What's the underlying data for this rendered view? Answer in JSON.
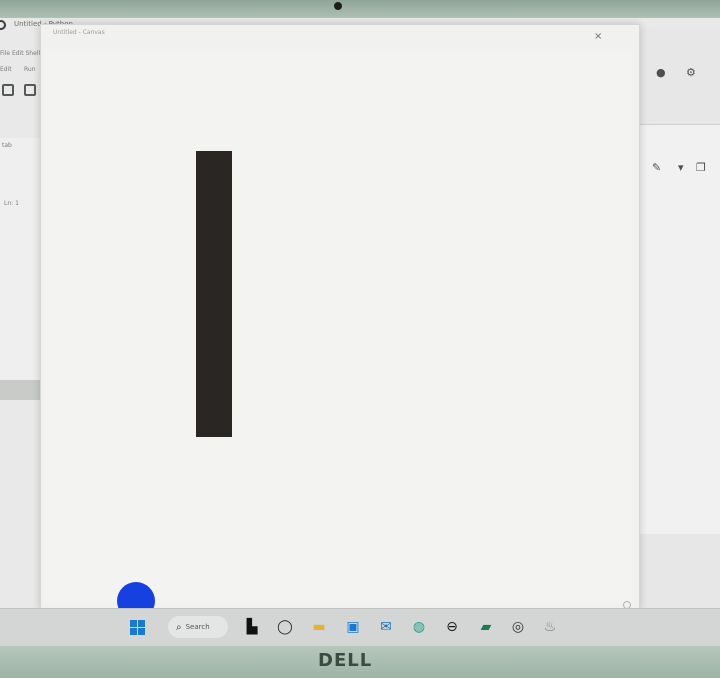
{
  "background_app": {
    "title": "Untitled - Python",
    "file_line": "File  Edit  Shell",
    "menu_a": "Edit",
    "menu_b": "Run",
    "panel_tab": "tab",
    "panel_text": "Ln: 1"
  },
  "dialog": {
    "title": "Untitled - Canvas",
    "close_glyph": "×"
  },
  "taskbar": {
    "search_label": "Search",
    "icons": [
      "start-icon",
      "search-icon",
      "task-view-icon",
      "chat-icon",
      "file-explorer-icon",
      "store-icon",
      "mail-icon",
      "edge-icon",
      "dell-icon",
      "teams-icon",
      "chrome-icon",
      "python-icon"
    ]
  },
  "brand": "DELL",
  "colors": {
    "rect": "#2a2623",
    "touch": "#1740e0",
    "accent": "#1a78d0"
  }
}
